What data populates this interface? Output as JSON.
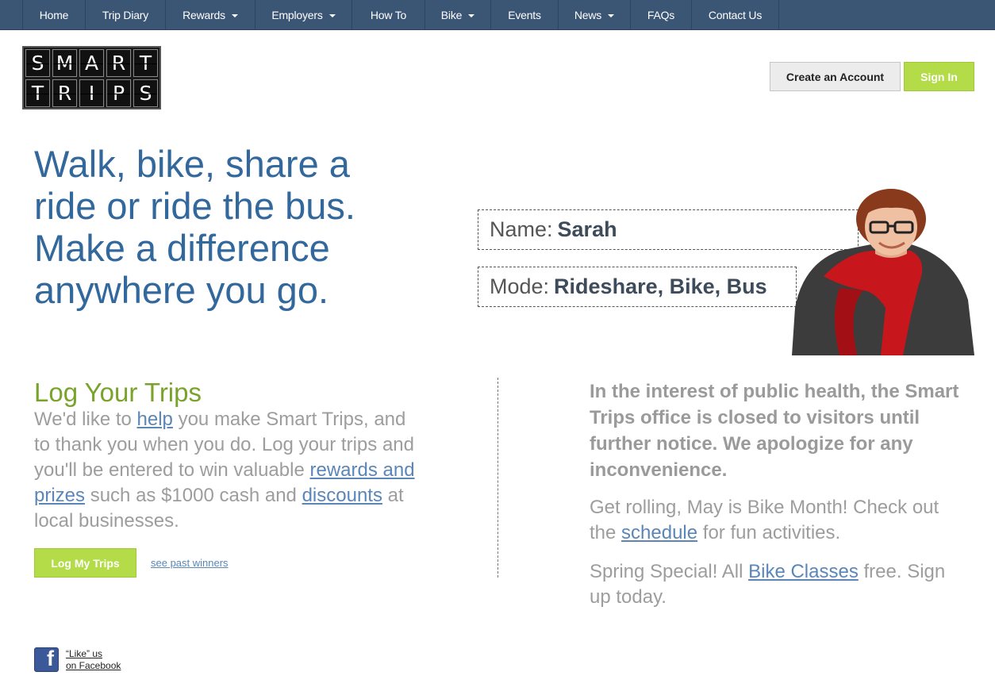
{
  "nav": {
    "items": [
      {
        "label": "Home"
      },
      {
        "label": "Trip Diary"
      },
      {
        "label": "Rewards"
      },
      {
        "label": "Employers"
      },
      {
        "label": "How To"
      },
      {
        "label": "Bike"
      },
      {
        "label": "Events"
      },
      {
        "label": "News"
      },
      {
        "label": "FAQs"
      },
      {
        "label": "Contact Us"
      }
    ]
  },
  "logo": {
    "row1": [
      "S",
      "M",
      "A",
      "R",
      "T"
    ],
    "row2": [
      "T",
      "R",
      "I",
      "P",
      "S"
    ]
  },
  "account": {
    "create_label": "Create an Account",
    "signin_label": "Sign In"
  },
  "hero": {
    "line1": "Walk, bike, share a",
    "line2": "ride or ride the bus.",
    "line3": "Make a difference",
    "line4": "anywhere you go."
  },
  "profile": {
    "name_label": "Name:",
    "name_value": "Sarah",
    "mode_label": "Mode:",
    "mode_value": "Rideshare, Bike, Bus"
  },
  "log_trips": {
    "title": "Log Your Trips",
    "t1": "We'd like to ",
    "link_help": "help",
    "t2": " you make Smart Trips, and to thank you when you do. Log your trips and you'll be entered to win valuable ",
    "link_rewards": "rewards and prizes",
    "t3": " such as $1000 cash and ",
    "link_discounts": "discounts",
    "t4": " at local businesses.",
    "button_label": "Log My Trips",
    "past_winners_label": "see past winners"
  },
  "notices": {
    "closed": "In the interest of public health, the Smart Trips office is closed to visitors until further notice. We apologize for any inconvenience.",
    "bike_t1": "Get rolling, May is Bike Month! Check out the ",
    "bike_link": "schedule",
    "bike_t2": " for fun activities.",
    "spring_t1": "Spring Special! All ",
    "spring_link": "Bike Classes",
    "spring_t2": " free. Sign up today."
  },
  "facebook": {
    "icon_glyph": "f",
    "line1": "“Like” us",
    "line2": "on Facebook"
  },
  "colors": {
    "nav_bg": "#3b5575",
    "accent_green": "#b3dc48",
    "hero_blue": "#33689d",
    "title_green": "#79a32a",
    "link_blue": "#5a86b8"
  },
  "icons": {
    "facebook": "facebook-icon",
    "caret": "caret-down-icon"
  }
}
